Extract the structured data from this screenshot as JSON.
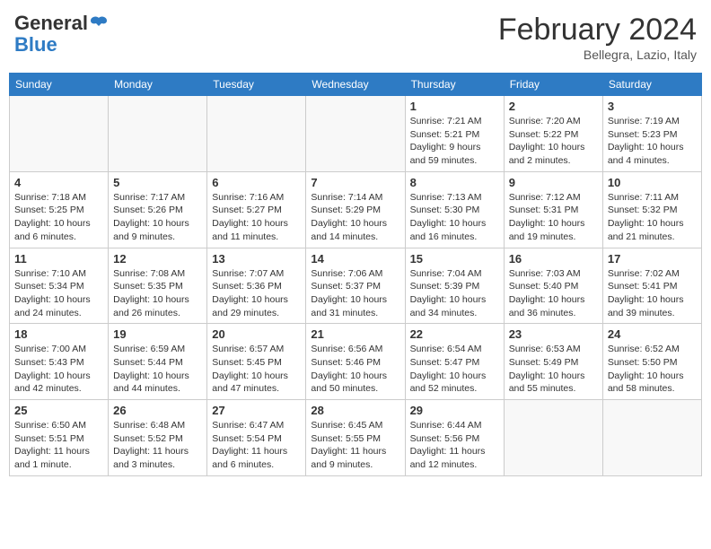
{
  "header": {
    "logo_text_general": "General",
    "logo_text_blue": "Blue",
    "month_title": "February 2024",
    "location": "Bellegra, Lazio, Italy"
  },
  "days_of_week": [
    "Sunday",
    "Monday",
    "Tuesday",
    "Wednesday",
    "Thursday",
    "Friday",
    "Saturday"
  ],
  "weeks": [
    [
      {
        "num": "",
        "info": ""
      },
      {
        "num": "",
        "info": ""
      },
      {
        "num": "",
        "info": ""
      },
      {
        "num": "",
        "info": ""
      },
      {
        "num": "1",
        "info": "Sunrise: 7:21 AM\nSunset: 5:21 PM\nDaylight: 9 hours and 59 minutes."
      },
      {
        "num": "2",
        "info": "Sunrise: 7:20 AM\nSunset: 5:22 PM\nDaylight: 10 hours and 2 minutes."
      },
      {
        "num": "3",
        "info": "Sunrise: 7:19 AM\nSunset: 5:23 PM\nDaylight: 10 hours and 4 minutes."
      }
    ],
    [
      {
        "num": "4",
        "info": "Sunrise: 7:18 AM\nSunset: 5:25 PM\nDaylight: 10 hours and 6 minutes."
      },
      {
        "num": "5",
        "info": "Sunrise: 7:17 AM\nSunset: 5:26 PM\nDaylight: 10 hours and 9 minutes."
      },
      {
        "num": "6",
        "info": "Sunrise: 7:16 AM\nSunset: 5:27 PM\nDaylight: 10 hours and 11 minutes."
      },
      {
        "num": "7",
        "info": "Sunrise: 7:14 AM\nSunset: 5:29 PM\nDaylight: 10 hours and 14 minutes."
      },
      {
        "num": "8",
        "info": "Sunrise: 7:13 AM\nSunset: 5:30 PM\nDaylight: 10 hours and 16 minutes."
      },
      {
        "num": "9",
        "info": "Sunrise: 7:12 AM\nSunset: 5:31 PM\nDaylight: 10 hours and 19 minutes."
      },
      {
        "num": "10",
        "info": "Sunrise: 7:11 AM\nSunset: 5:32 PM\nDaylight: 10 hours and 21 minutes."
      }
    ],
    [
      {
        "num": "11",
        "info": "Sunrise: 7:10 AM\nSunset: 5:34 PM\nDaylight: 10 hours and 24 minutes."
      },
      {
        "num": "12",
        "info": "Sunrise: 7:08 AM\nSunset: 5:35 PM\nDaylight: 10 hours and 26 minutes."
      },
      {
        "num": "13",
        "info": "Sunrise: 7:07 AM\nSunset: 5:36 PM\nDaylight: 10 hours and 29 minutes."
      },
      {
        "num": "14",
        "info": "Sunrise: 7:06 AM\nSunset: 5:37 PM\nDaylight: 10 hours and 31 minutes."
      },
      {
        "num": "15",
        "info": "Sunrise: 7:04 AM\nSunset: 5:39 PM\nDaylight: 10 hours and 34 minutes."
      },
      {
        "num": "16",
        "info": "Sunrise: 7:03 AM\nSunset: 5:40 PM\nDaylight: 10 hours and 36 minutes."
      },
      {
        "num": "17",
        "info": "Sunrise: 7:02 AM\nSunset: 5:41 PM\nDaylight: 10 hours and 39 minutes."
      }
    ],
    [
      {
        "num": "18",
        "info": "Sunrise: 7:00 AM\nSunset: 5:43 PM\nDaylight: 10 hours and 42 minutes."
      },
      {
        "num": "19",
        "info": "Sunrise: 6:59 AM\nSunset: 5:44 PM\nDaylight: 10 hours and 44 minutes."
      },
      {
        "num": "20",
        "info": "Sunrise: 6:57 AM\nSunset: 5:45 PM\nDaylight: 10 hours and 47 minutes."
      },
      {
        "num": "21",
        "info": "Sunrise: 6:56 AM\nSunset: 5:46 PM\nDaylight: 10 hours and 50 minutes."
      },
      {
        "num": "22",
        "info": "Sunrise: 6:54 AM\nSunset: 5:47 PM\nDaylight: 10 hours and 52 minutes."
      },
      {
        "num": "23",
        "info": "Sunrise: 6:53 AM\nSunset: 5:49 PM\nDaylight: 10 hours and 55 minutes."
      },
      {
        "num": "24",
        "info": "Sunrise: 6:52 AM\nSunset: 5:50 PM\nDaylight: 10 hours and 58 minutes."
      }
    ],
    [
      {
        "num": "25",
        "info": "Sunrise: 6:50 AM\nSunset: 5:51 PM\nDaylight: 11 hours and 1 minute."
      },
      {
        "num": "26",
        "info": "Sunrise: 6:48 AM\nSunset: 5:52 PM\nDaylight: 11 hours and 3 minutes."
      },
      {
        "num": "27",
        "info": "Sunrise: 6:47 AM\nSunset: 5:54 PM\nDaylight: 11 hours and 6 minutes."
      },
      {
        "num": "28",
        "info": "Sunrise: 6:45 AM\nSunset: 5:55 PM\nDaylight: 11 hours and 9 minutes."
      },
      {
        "num": "29",
        "info": "Sunrise: 6:44 AM\nSunset: 5:56 PM\nDaylight: 11 hours and 12 minutes."
      },
      {
        "num": "",
        "info": ""
      },
      {
        "num": "",
        "info": ""
      }
    ]
  ]
}
